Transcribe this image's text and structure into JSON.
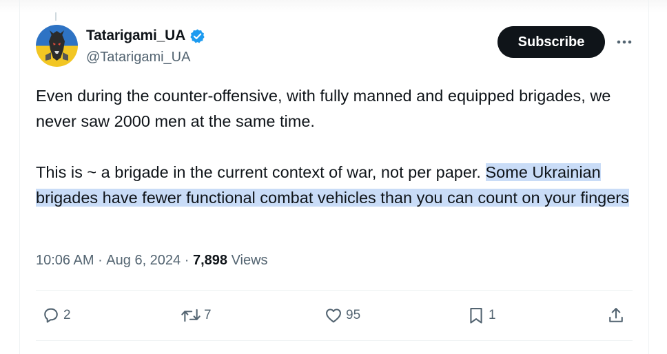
{
  "author": {
    "display_name": "Tatarigami_UA",
    "handle": "@Tatarigami_UA",
    "verified": true,
    "verified_color": "#1d9bf0"
  },
  "subscribe_label": "Subscribe",
  "more_icon": "ellipsis-icon",
  "tweet": {
    "paragraph1": "Even during the counter-offensive, with fully manned and equipped brigades, we never saw 2000 men at the same time.",
    "paragraph2_plain": "This is ~ a brigade in the current context of war, not per paper. ",
    "paragraph2_highlighted": "Some Ukrainian brigades have fewer functional combat vehicles than you can count on your fingers",
    "highlight_color": "#c9dcf7"
  },
  "meta": {
    "time": "10:06 AM",
    "separator": " · ",
    "date": "Aug 6, 2024",
    "views_count": "7,898",
    "views_label": " Views"
  },
  "actions": {
    "replies": {
      "icon": "reply-icon",
      "count": "2"
    },
    "reposts": {
      "icon": "repost-icon",
      "count": "7"
    },
    "likes": {
      "icon": "heart-icon",
      "count": "95"
    },
    "bookmarks": {
      "icon": "bookmark-icon",
      "count": "1"
    },
    "share": {
      "icon": "share-icon"
    }
  }
}
